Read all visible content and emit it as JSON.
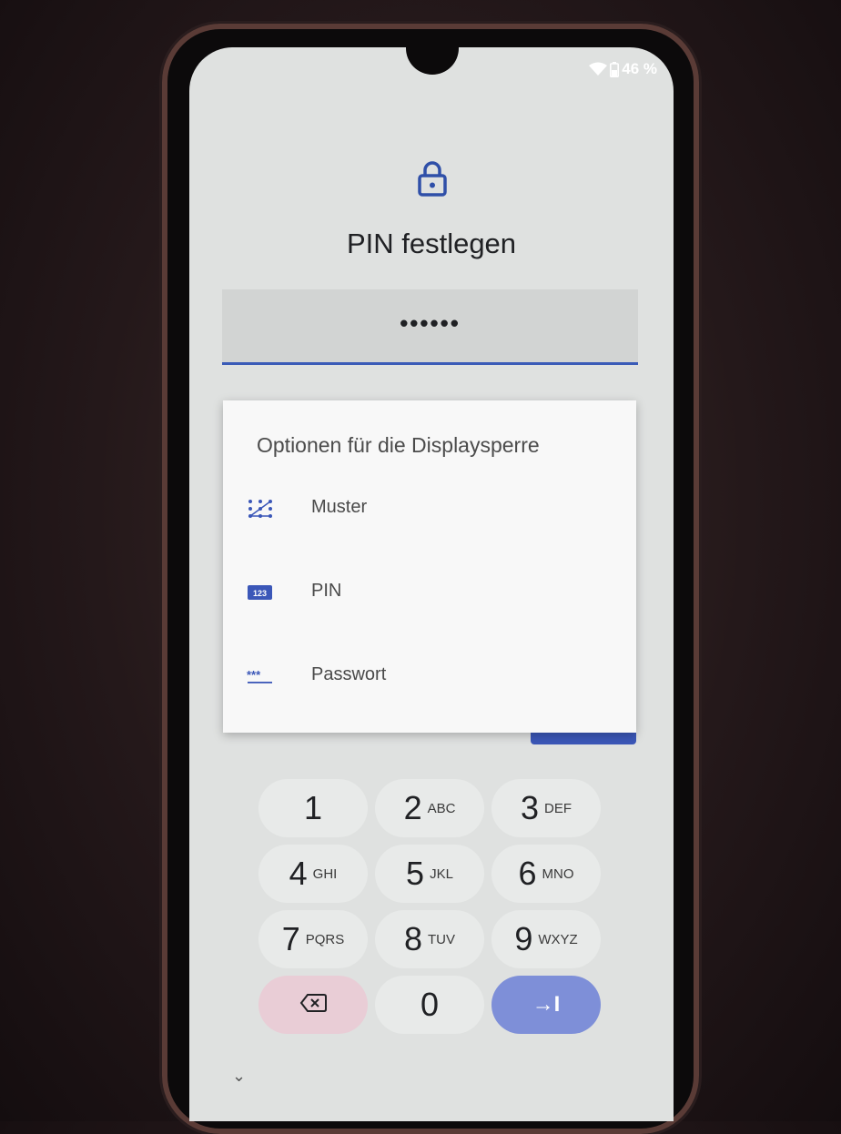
{
  "status_bar": {
    "battery": "46 %"
  },
  "header": {
    "title": "PIN festlegen"
  },
  "pin_field": {
    "value": "••••••"
  },
  "dialog": {
    "title": "Optionen für die Displaysperre",
    "options": [
      {
        "label": "Muster",
        "icon": "pattern-icon"
      },
      {
        "label": "PIN",
        "icon": "pin-123-icon"
      },
      {
        "label": "Passwort",
        "icon": "password-icon"
      }
    ]
  },
  "keypad": {
    "keys": [
      {
        "num": "1",
        "letters": ""
      },
      {
        "num": "2",
        "letters": "ABC"
      },
      {
        "num": "3",
        "letters": "DEF"
      },
      {
        "num": "4",
        "letters": "GHI"
      },
      {
        "num": "5",
        "letters": "JKL"
      },
      {
        "num": "6",
        "letters": "MNO"
      },
      {
        "num": "7",
        "letters": "PQRS"
      },
      {
        "num": "8",
        "letters": "TUV"
      },
      {
        "num": "9",
        "letters": "WXYZ"
      },
      {
        "num": "0",
        "letters": ""
      }
    ],
    "delete_icon": "backspace-icon",
    "enter_icon": "tab-arrow-icon",
    "enter_label": "→I"
  },
  "colors": {
    "accent": "#3b57b8",
    "delete_key": "#e9cdd6",
    "enter_key": "#7e8fd8"
  }
}
